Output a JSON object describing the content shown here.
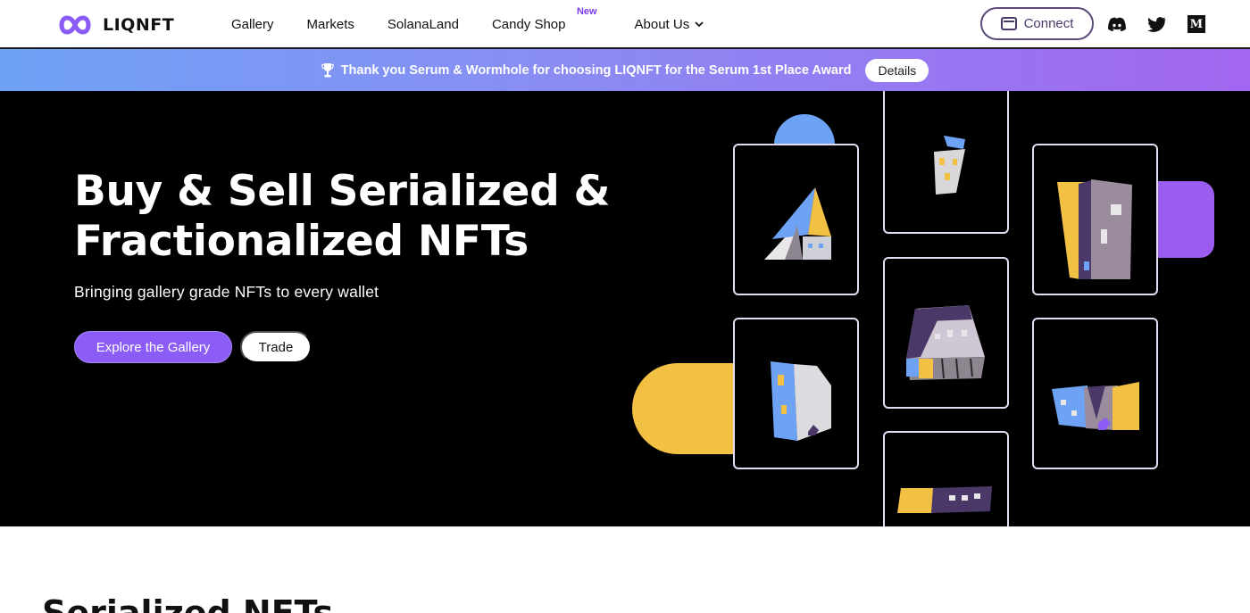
{
  "brand": {
    "name": "LIQNFT",
    "accent": "#8b5cf6",
    "logo_icon": "infinity-icon"
  },
  "nav": {
    "items": [
      {
        "label": "Gallery"
      },
      {
        "label": "Markets"
      },
      {
        "label": "SolanaLand"
      },
      {
        "label": "Candy Shop",
        "badge": "New"
      },
      {
        "label": "About Us",
        "icon": "chevron-down-icon"
      }
    ],
    "connect_label": "Connect",
    "socials": [
      "discord-icon",
      "twitter-icon",
      "medium-icon"
    ]
  },
  "banner": {
    "icon": "trophy-icon",
    "text": "Thank you Serum & Wormhole for choosing LIQNFT for the Serum 1st Place Award",
    "button": "Details"
  },
  "hero": {
    "title": "Buy & Sell Serialized & Fractionalized NFTs",
    "subtitle": "Bringing gallery grade NFTs to every wallet",
    "primary_button": "Explore the Gallery",
    "secondary_button": "Trade"
  },
  "section": {
    "title": "Serialized NFTs"
  },
  "colors": {
    "yellow": "#f2c043",
    "blue": "#6ea2f5",
    "purple": "#9b5cf0",
    "dark_purple": "#4a3868",
    "card_border": "#e4dcf5"
  }
}
